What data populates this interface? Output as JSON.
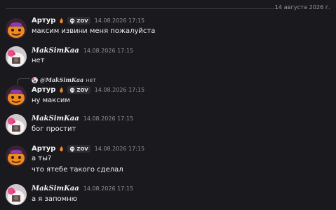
{
  "date_divider": "14 августа 2026 г.",
  "messages": [
    {
      "author": "Артур",
      "tag": "ZOV",
      "time": "14.08.2026 17:15",
      "text": "максим извини меня пожалуйста"
    },
    {
      "author": "MakSimKaa",
      "time": "14.08.2026 17:15",
      "text": "нет"
    },
    {
      "reply_author": "@MakSimKaa",
      "reply_text": "нет",
      "author": "Артур",
      "tag": "ZOV",
      "time": "14.08.2026 17:15",
      "text": "ну максим"
    },
    {
      "author": "MakSimKaa",
      "time": "14.08.2026 17:15",
      "text": "бог простит"
    },
    {
      "author": "Артур",
      "tag": "ZOV",
      "time": "14.08.2026 17:15",
      "text": "а ты?",
      "text2": "что ятебе такого сделал"
    },
    {
      "author": "MakSimKaa",
      "time": "14.08.2026 17:15",
      "text": "а я запомню"
    }
  ],
  "colors": {
    "background": "#1a1a1e",
    "text": "#eceef1",
    "timestamp": "#8e9297"
  },
  "icons": [
    "pumpkin-avatar",
    "hello-kitty-avatar",
    "fire-badge-icon",
    "skull-tag-icon"
  ]
}
